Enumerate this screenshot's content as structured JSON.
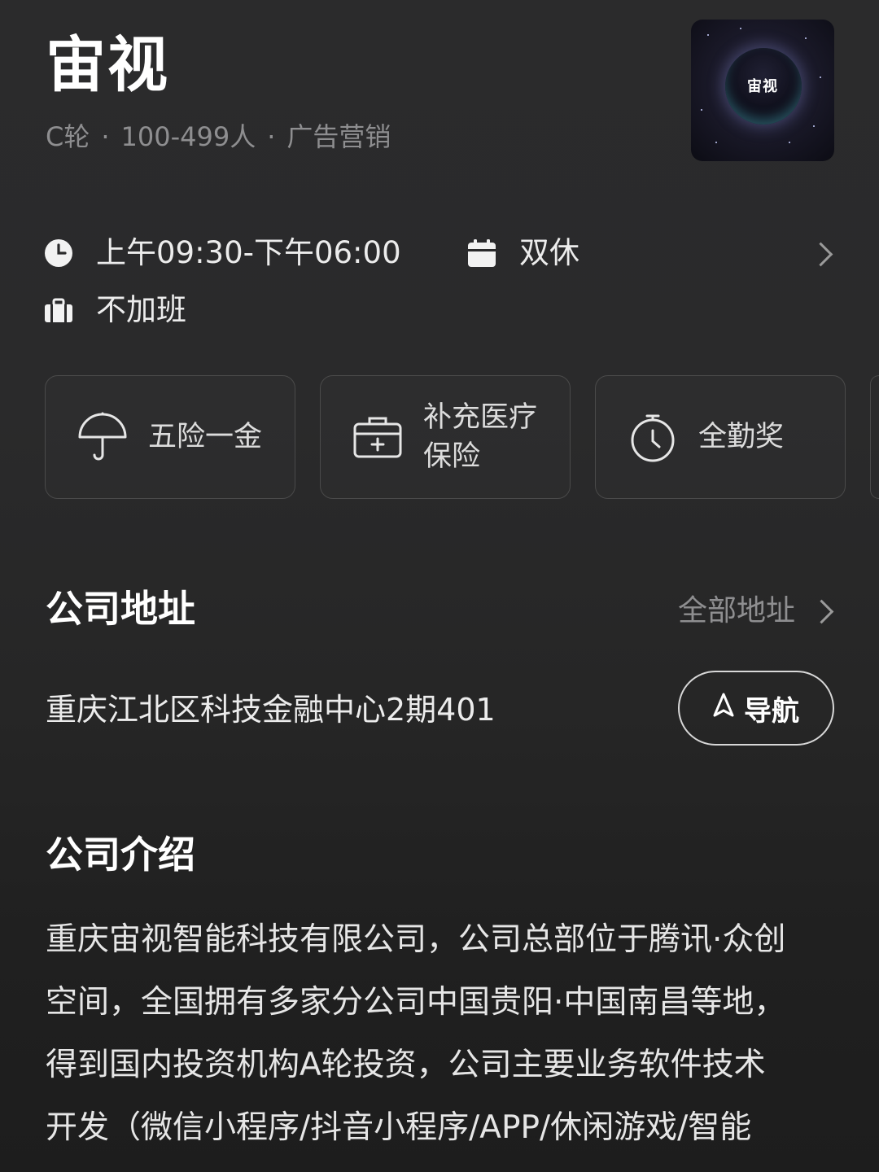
{
  "company": {
    "name": "宙视",
    "meta": [
      "C轮",
      "100-499人",
      "广告营销"
    ],
    "logo_text": "宙视"
  },
  "schedule": {
    "hours": "上午09:30-下午06:00",
    "rest": "双休",
    "overtime": "不加班"
  },
  "benefits": [
    {
      "label_lines": [
        "五险一金"
      ],
      "icon": "umbrella-icon"
    },
    {
      "label_lines": [
        "补充医疗",
        "保险"
      ],
      "icon": "medical-kit-icon"
    },
    {
      "label_lines": [
        "全勤奖"
      ],
      "icon": "stopwatch-icon"
    }
  ],
  "address_section": {
    "title": "公司地址",
    "all_link": "全部地址",
    "address": "重庆江北区科技金融中心2期401",
    "nav_label": "导航"
  },
  "intro_section": {
    "title": "公司介绍",
    "lines": [
      "重庆宙视智能科技有限公司，公司总部位于腾讯·众创",
      "空间，全国拥有多家分公司中国贵阳·中国南昌等地，",
      "得到国内投资机构A轮投资，公司主要业务软件技术",
      "开发（微信小程序/抖音小程序/APP/休闲游戏/智能"
    ]
  },
  "colors": {
    "background": "#2a2a2b",
    "text_primary": "#ffffff",
    "text_secondary": "#8e8e90",
    "card_border": "#4a4a4a"
  }
}
